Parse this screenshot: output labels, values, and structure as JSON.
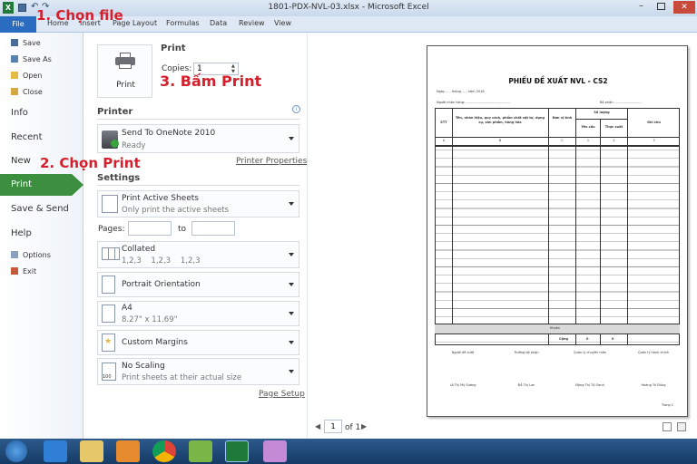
{
  "window": {
    "title": "1801-PDX-NVL-03.xlsx - Microsoft Excel"
  },
  "ribbon": {
    "file": "File",
    "tabs": [
      "Home",
      "Insert",
      "Page Layout",
      "Formulas",
      "Data",
      "Review",
      "View"
    ]
  },
  "backstage": {
    "small_items": [
      "Save",
      "Save As",
      "Open",
      "Close"
    ],
    "big_items": [
      "Info",
      "Recent",
      "New",
      "Print",
      "Save & Send",
      "Help"
    ],
    "bottom_items": [
      "Options",
      "Exit"
    ]
  },
  "print": {
    "heading": "Print",
    "copies_label": "Copies:",
    "copies_value": "1",
    "button_label": "Print",
    "printer_heading": "Printer",
    "printer_name": "Send To OneNote 2010",
    "printer_status": "Ready",
    "printer_properties": "Printer Properties",
    "settings_heading": "Settings",
    "settings": [
      {
        "title": "Print Active Sheets",
        "sub": "Only print the active sheets"
      },
      {
        "title": "Collated",
        "sub": "1,2,3    1,2,3    1,2,3"
      },
      {
        "title": "Portrait Orientation",
        "sub": ""
      },
      {
        "title": "A4",
        "sub": "8.27\" x 11.69\""
      },
      {
        "title": "Custom Margins",
        "sub": ""
      },
      {
        "title": "No Scaling",
        "sub": "Print sheets at their actual size"
      }
    ],
    "pages_label": "Pages:",
    "to_label": "to",
    "page_setup": "Page Setup"
  },
  "preview": {
    "title": "PHIẾU ĐỀ XUẤT NVL  - CS2",
    "date_line": "Ngày ..... tháng ..... năm 2018",
    "department": "Bộ phận: ..........................",
    "requester": "Người nhận hàng: ............................................",
    "headers": {
      "stt": "STT",
      "name": "Tên, nhãn hiệu, quy cách, phẩm chất vật tư, dụng cụ, sản phẩm, hàng hóa",
      "unit": "Đơn vị tính",
      "qty": "Số lượng",
      "req": "Yêu cầu",
      "act": "Thực xuất",
      "note": "Ghi chú"
    },
    "col_letters": [
      "A",
      "B",
      "C",
      "1",
      "2",
      "3"
    ],
    "khoan": "Khoản",
    "total_label": "Cộng",
    "total_values": [
      "0",
      "0"
    ],
    "signers": [
      "Người đề xuất",
      "Trưởng bộ phận",
      "Quản lý chuyên môn",
      "Quản lý hành chính"
    ],
    "signer_names": [
      "Lã Thị Mỹ Sương",
      "Đỗ Thị Lan",
      "Đặng Thị Tố Oanh",
      "Hoàng Trí Dũng"
    ],
    "page_footer": "Trang 1"
  },
  "pager": {
    "current": "1",
    "of": "of 1"
  },
  "annotations": {
    "a1": "1. Chọn file",
    "a2": "2. Chọn Print",
    "a3": "3. Bấm Print"
  }
}
